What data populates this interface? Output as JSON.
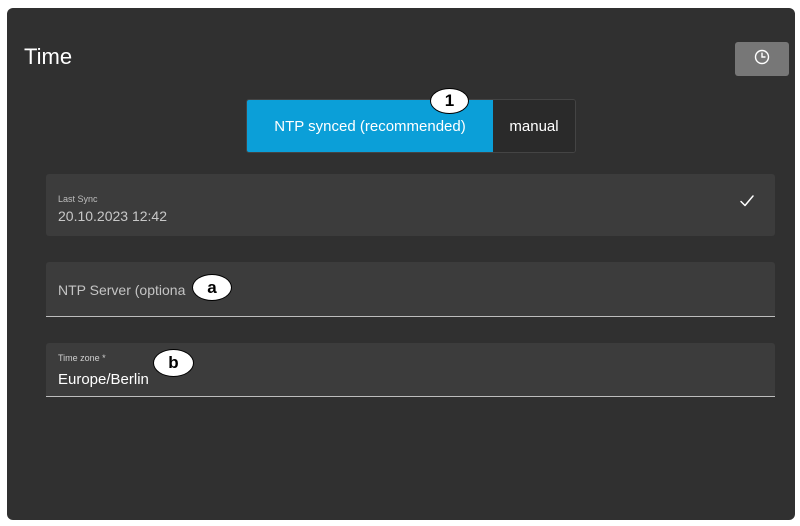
{
  "header": {
    "title": "Time",
    "clock_button_icon": "clock-icon"
  },
  "sync_mode": {
    "options": [
      "NTP synced (recommended)",
      "manual"
    ],
    "selected": "NTP synced (recommended)",
    "active_color": "#0b9fd8"
  },
  "last_sync": {
    "label": "Last Sync",
    "value": "20.10.2023 12:42",
    "status_icon": "checkmark-icon"
  },
  "ntp_server": {
    "placeholder": "NTP Server (optiona",
    "value": ""
  },
  "time_zone": {
    "label": "Time zone *",
    "value": "Europe/Berlin"
  },
  "markers": {
    "m1": "1",
    "ma": "a",
    "mb": "b"
  },
  "colors": {
    "panel_bg": "#303030",
    "field_bg": "#3c3c3c",
    "accent": "#0b9fd8"
  }
}
